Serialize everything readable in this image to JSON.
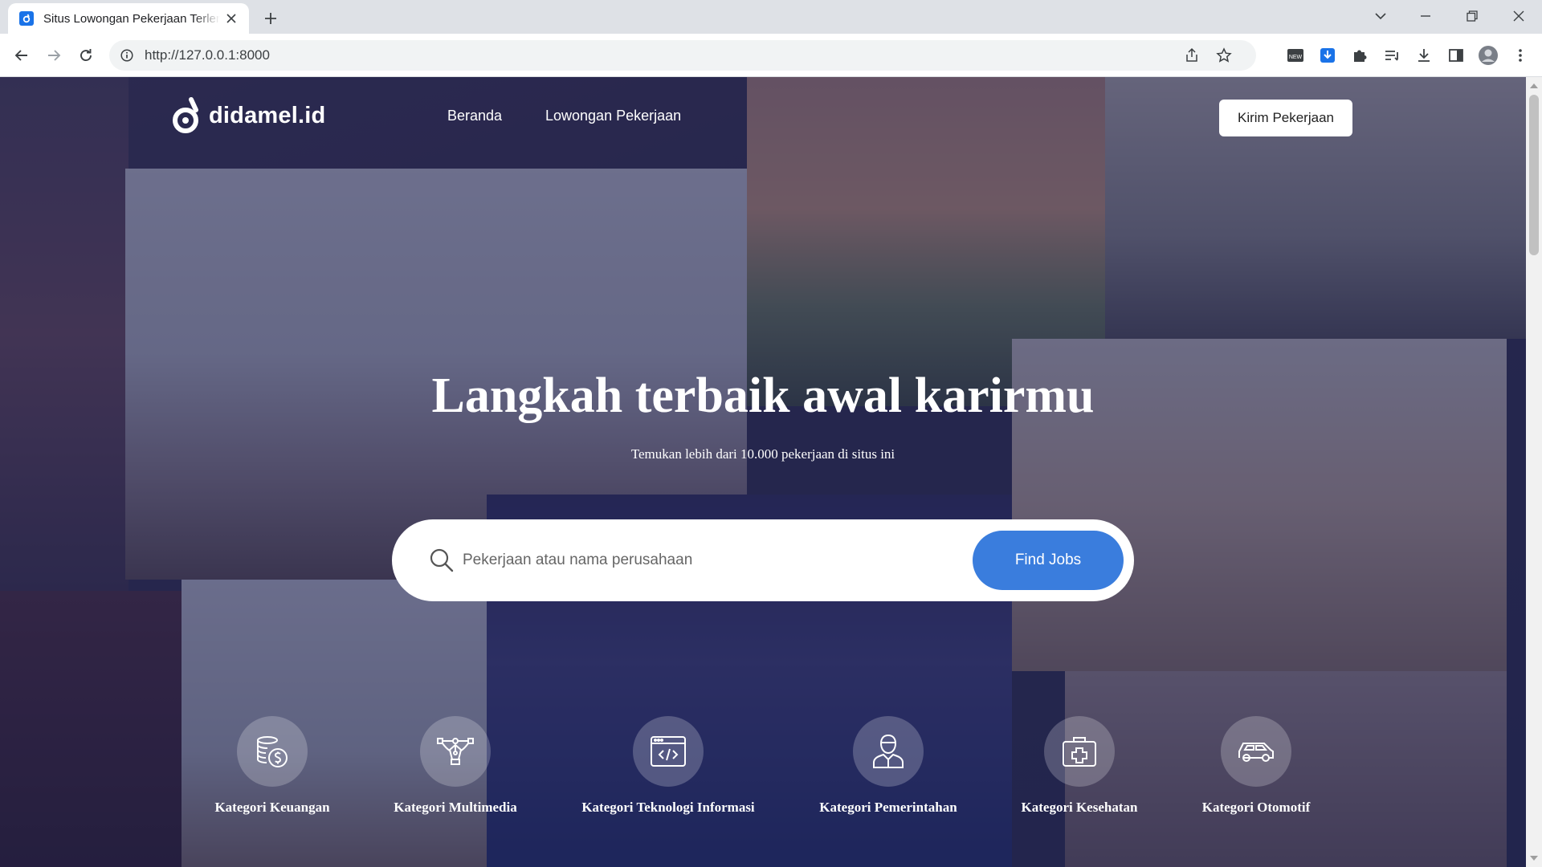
{
  "browser": {
    "tab_title": "Situs Lowongan Pekerjaan Terlengkap",
    "url": "http://127.0.0.1:8000"
  },
  "navbar": {
    "logo_text": "didamel.id",
    "links": [
      "Beranda",
      "Lowongan Pekerjaan"
    ],
    "post_button": "Kirim Pekerjaan"
  },
  "hero": {
    "title": "Langkah terbaik awal karirmu",
    "subtitle": "Temukan lebih dari 10.000 pekerjaan di situs ini"
  },
  "search": {
    "placeholder": "Pekerjaan atau nama perusahaan",
    "button": "Find Jobs"
  },
  "categories": [
    {
      "label": "Kategori Keuangan",
      "icon": "coins-dollar-icon"
    },
    {
      "label": "Kategori Multimedia",
      "icon": "pen-tool-icon"
    },
    {
      "label": "Kategori Teknologi Informasi",
      "icon": "code-window-icon"
    },
    {
      "label": "Kategori Pemerintahan",
      "icon": "officer-icon"
    },
    {
      "label": "Kategori Kesehatan",
      "icon": "medical-kit-icon"
    },
    {
      "label": "Kategori Otomotif",
      "icon": "car-icon"
    }
  ],
  "colors": {
    "accent": "#3a7ddd",
    "overlay": "#202250"
  }
}
